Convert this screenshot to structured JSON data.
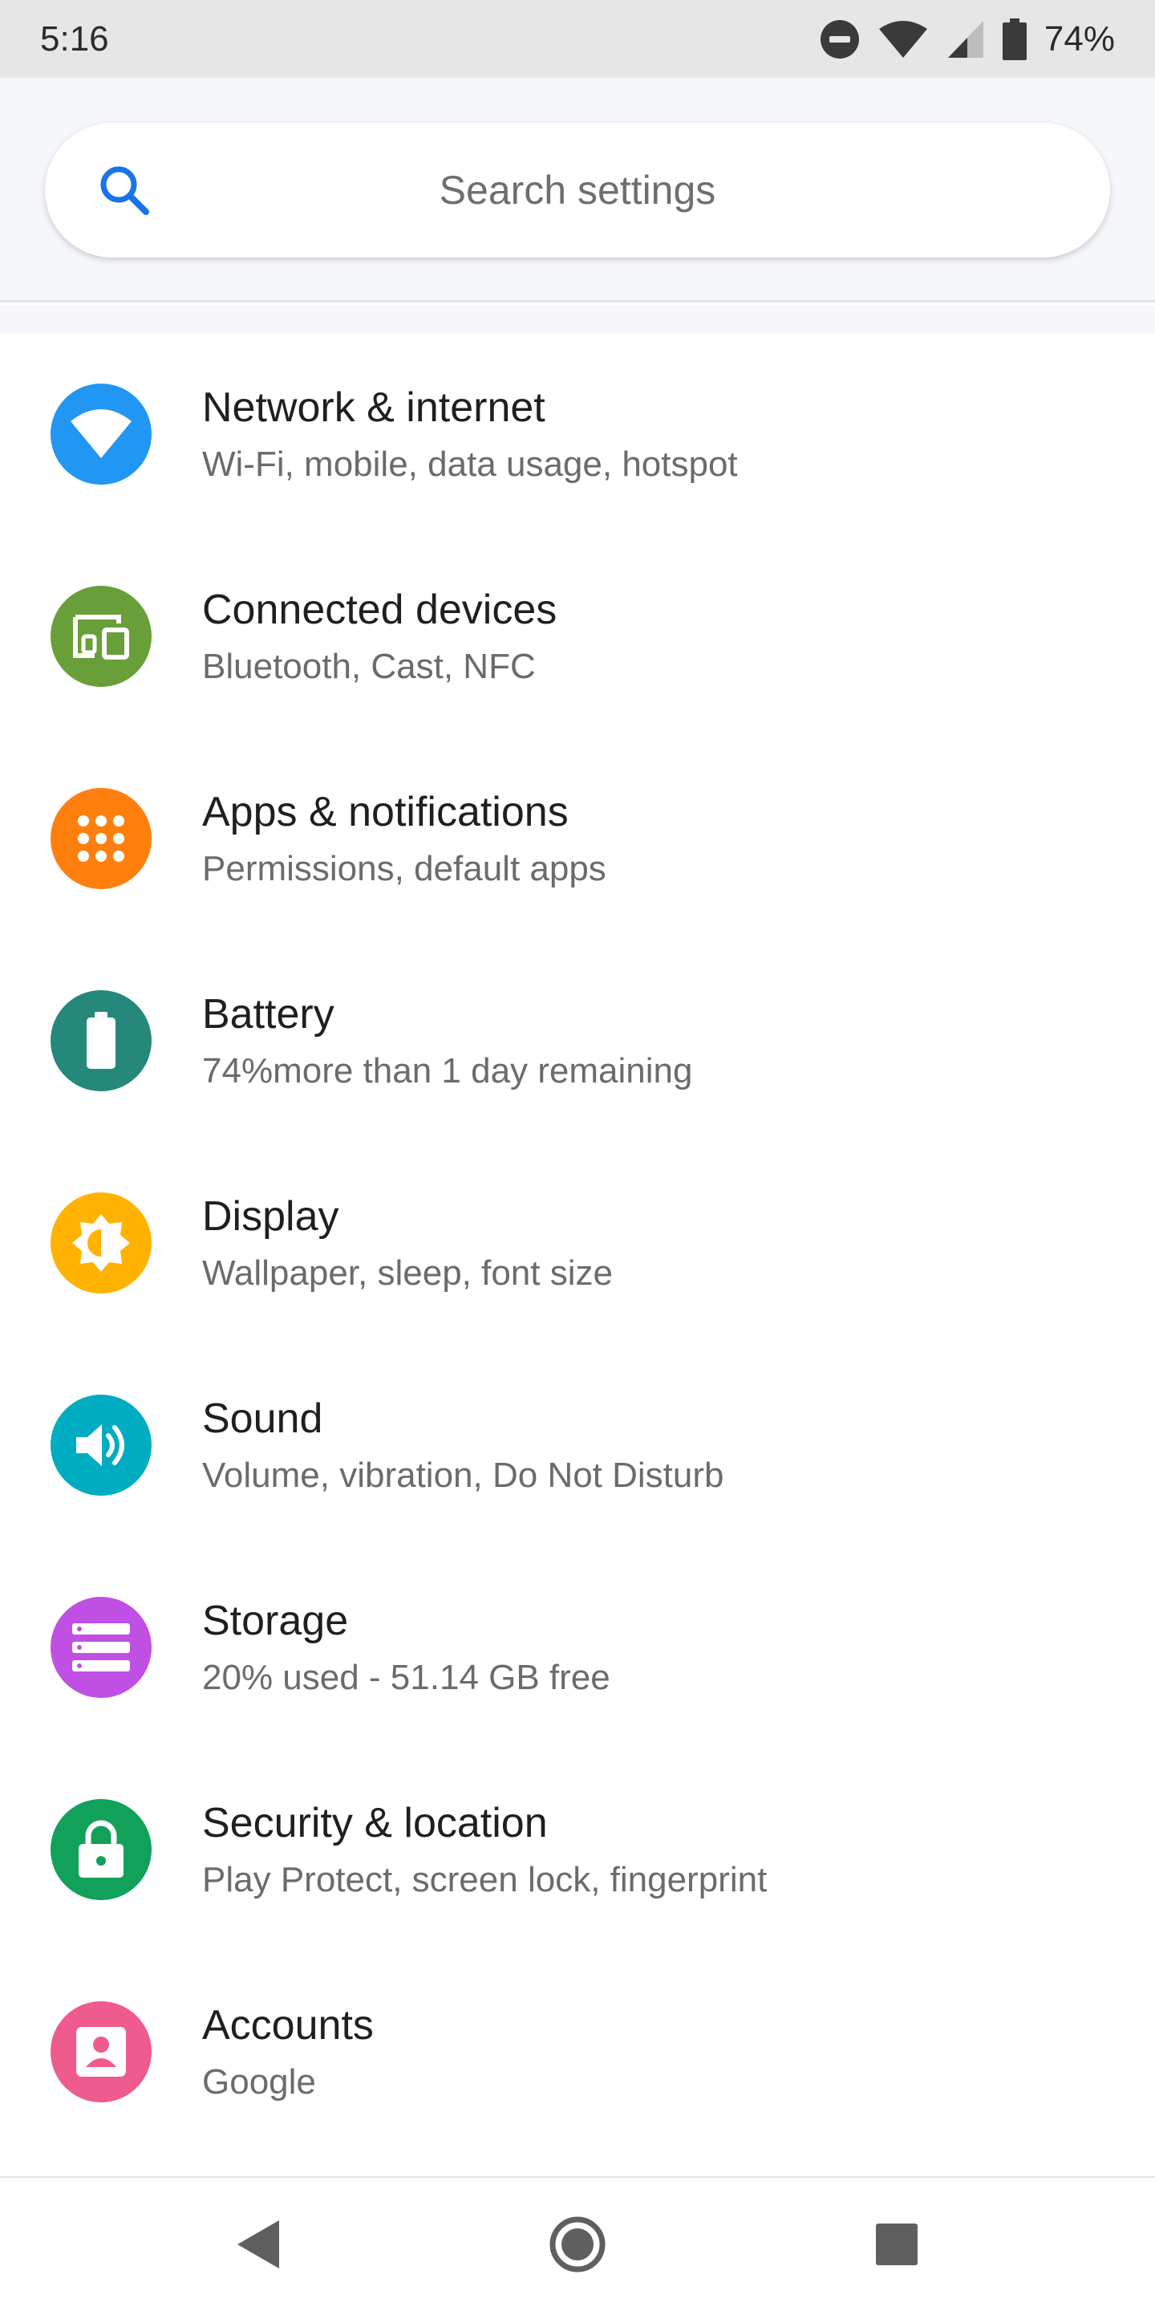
{
  "status_bar": {
    "time": "5:16",
    "battery_pct": "74%",
    "icons": [
      "do-not-disturb-icon",
      "wifi-icon",
      "cellular-signal-icon",
      "battery-icon"
    ]
  },
  "search": {
    "placeholder": "Search settings",
    "icon": "search-icon"
  },
  "settings": [
    {
      "id": "network",
      "title": "Network & internet",
      "subtitle": "Wi-Fi, mobile, data usage, hotspot",
      "icon": "wifi-icon",
      "color": "#2196F3"
    },
    {
      "id": "connected-devices",
      "title": "Connected devices",
      "subtitle": "Bluetooth, Cast, NFC",
      "icon": "devices-icon",
      "color": "#689F38"
    },
    {
      "id": "apps",
      "title": "Apps & notifications",
      "subtitle": "Permissions, default apps",
      "icon": "apps-grid-icon",
      "color": "#FF7F0E"
    },
    {
      "id": "battery",
      "title": "Battery",
      "subtitle": "74%more than 1 day remaining",
      "icon": "battery-icon",
      "color": "#26887A"
    },
    {
      "id": "display",
      "title": "Display",
      "subtitle": "Wallpaper, sleep, font size",
      "icon": "brightness-icon",
      "color": "#FFB300"
    },
    {
      "id": "sound",
      "title": "Sound",
      "subtitle": "Volume, vibration, Do Not Disturb",
      "icon": "volume-icon",
      "color": "#00ACC1"
    },
    {
      "id": "storage",
      "title": "Storage",
      "subtitle": "20% used - 51.14 GB free",
      "icon": "storage-icon",
      "color": "#C04FE3"
    },
    {
      "id": "security",
      "title": "Security & location",
      "subtitle": "Play Protect, screen lock, fingerprint",
      "icon": "lock-icon",
      "color": "#12A15A"
    },
    {
      "id": "accounts",
      "title": "Accounts",
      "subtitle": "Google",
      "icon": "account-icon",
      "color": "#EF5A8F"
    }
  ],
  "nav_bar": {
    "buttons": [
      "back-icon",
      "home-icon",
      "recents-icon"
    ]
  }
}
